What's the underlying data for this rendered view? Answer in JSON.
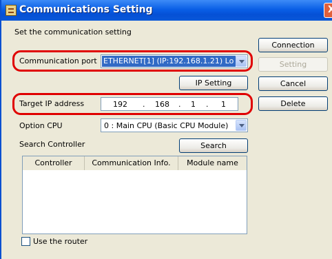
{
  "window": {
    "title": "Communications Setting",
    "close_glyph": "X"
  },
  "labels": {
    "set_comm": "Set the communication setting",
    "comm_port": "Communication port",
    "target_ip": "Target IP address",
    "option_cpu": "Option CPU",
    "search_controller": "Search Controller"
  },
  "comm_port": {
    "value": "ETHERNET[1]  (IP:192.168.1.21) Lo"
  },
  "ip_address": {
    "octets": [
      "192",
      "168",
      "1",
      "1"
    ],
    "separator": "."
  },
  "option_cpu": {
    "value": "0 : Main CPU (Basic CPU Module)"
  },
  "buttons": {
    "ip_setting": "IP Setting",
    "search": "Search",
    "connection": "Connection",
    "setting": "Setting",
    "cancel": "Cancel",
    "delete": "Delete"
  },
  "table": {
    "columns": [
      "Controller",
      "Communication Info.",
      "Module name"
    ],
    "rows": []
  },
  "use_router": {
    "label": "Use the router",
    "checked": false
  },
  "highlight_color": "#e00000",
  "icons": {
    "app": "app-icon",
    "dropdown": "chevron-down-icon",
    "close": "close-icon"
  }
}
